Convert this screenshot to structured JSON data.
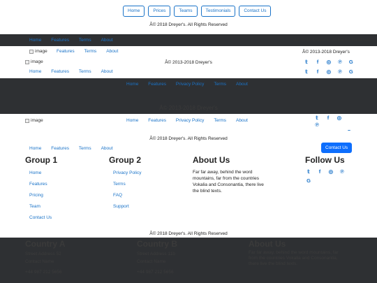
{
  "footer1": {
    "buttons": [
      "Home",
      "Prices",
      "Teams",
      "Testimonials",
      "Contact Us"
    ],
    "copyright": "Â© 2018 Dreyer's. All Rights Reserved"
  },
  "footer2": {
    "nav": [
      "Home",
      "Features",
      "Terms",
      "About"
    ],
    "copyright": "Â© 2018 Dreyer's. All Rights Reserved"
  },
  "footer3": {
    "image_alt": "image",
    "nav": [
      "Features",
      "Terms",
      "About"
    ],
    "copyright": "Â© 2013-2018 Dreyer's",
    "social": [
      "twitter-icon",
      "facebook-icon",
      "instagram-icon",
      "pinterest-icon",
      "google-icon"
    ]
  },
  "footer4": {
    "image_alt": "image",
    "copyright": "Â© 2013-2018 Dreyer's",
    "nav": [
      "Home",
      "Features",
      "Terms",
      "About"
    ],
    "social": [
      "twitter-icon",
      "facebook-icon",
      "instagram-icon",
      "pinterest-icon",
      "google-icon"
    ]
  },
  "footer5": {
    "nav": [
      "Home",
      "Features",
      "Privacy Policy",
      "Terms",
      "About"
    ],
    "copyright": "Â© 2013-2018 Dreyer's"
  },
  "footer6": {
    "image_alt": "image",
    "nav": [
      "Home",
      "Features",
      "Privacy Policy",
      "Terms",
      "About"
    ],
    "social": [
      "twitter-icon",
      "facebook-icon",
      "instagram-icon",
      "pinterest-icon",
      "google-icon"
    ]
  },
  "footer7": {
    "copyright": "Â© 2018 Dreyer's. All Rights Reserved",
    "nav": [
      "Home",
      "Features",
      "Terms",
      "About"
    ],
    "contact_button": "Contact Us"
  },
  "footer8": {
    "group1": {
      "title": "Group 1",
      "items": [
        "Home",
        "Features",
        "Pricing",
        "Team",
        "Contact Us"
      ]
    },
    "group2": {
      "title": "Group 2",
      "items": [
        "Privacy Policy",
        "Terms",
        "FAQ",
        "Support"
      ]
    },
    "about": {
      "title": "About Us",
      "text": "Far far away, behind the word mountains, far from the countries Vokalia and Consonantia, there live the blind texts."
    },
    "follow": {
      "title": "Follow Us",
      "social": [
        "twitter-icon",
        "facebook-icon",
        "instagram-icon",
        "pinterest-icon",
        "google-icon"
      ]
    },
    "copyright": "Â© 2018 Dreyer's. All Rights Reserved"
  },
  "footer9": {
    "countryA": {
      "title": "Country A",
      "lines": [
        "Street Address 52",
        "Contact Name",
        "+44 987 212 5656"
      ]
    },
    "countryB": {
      "title": "Country B",
      "lines": [
        "Street Address 11b",
        "Contact Name",
        "+44 987 212 5656"
      ]
    },
    "about": {
      "title": "About Us",
      "text": "Far far away, behind the word mountains, far from the countries Vokalia and Consonantia, there live the blind texts."
    }
  },
  "colors": {
    "link": "#1a73c8",
    "dark": "#2e3033",
    "button": "#0d6efd"
  }
}
